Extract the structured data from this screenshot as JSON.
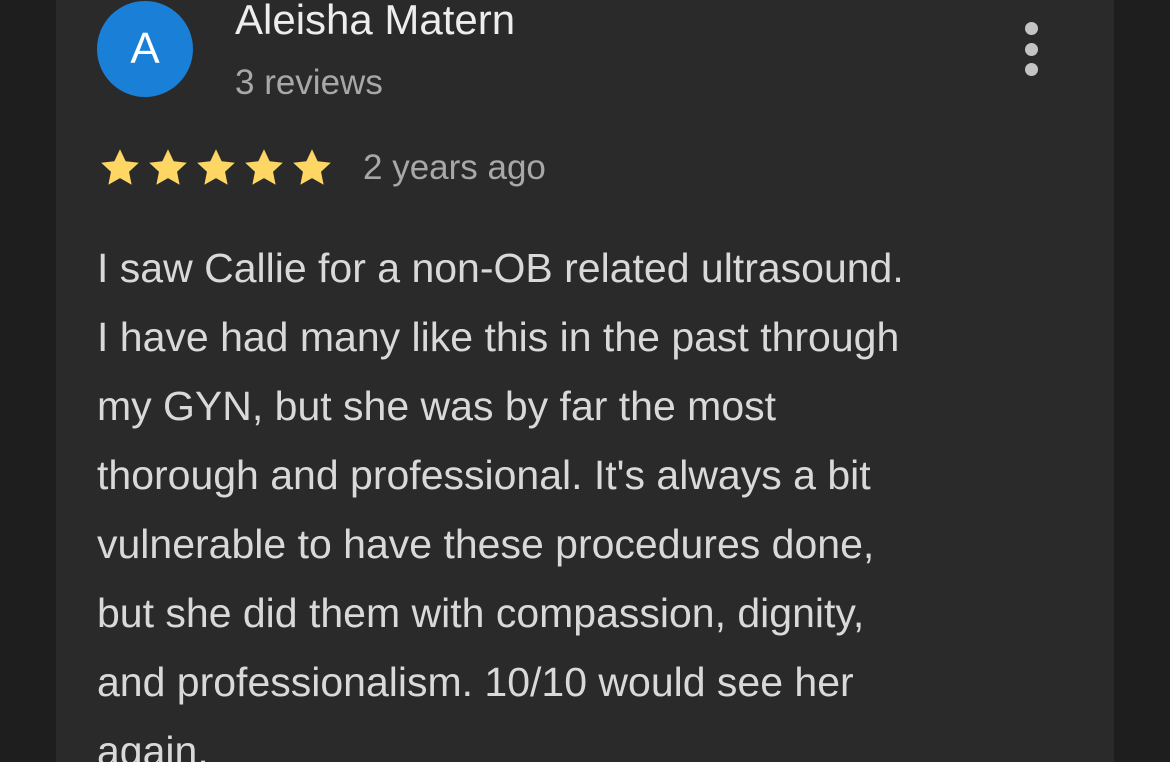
{
  "review": {
    "avatar_letter": "A",
    "author_name": "Aleisha Matern",
    "review_count": "3 reviews",
    "rating": 5,
    "rating_max": 5,
    "time_ago": "2 years ago",
    "text_lines": [
      "I saw Callie for a non-OB related ultrasound.",
      "I have had many like this in the past through",
      "my GYN, but she was by far the most",
      "thorough and professional. It's always a bit",
      "vulnerable to have these procedures done,",
      "but she did them with compassion, dignity,",
      "and professionalism. 10/10 would see her",
      "again."
    ]
  },
  "icons": {
    "more": "more-vert-icon",
    "star": "star-icon"
  },
  "colors": {
    "background": "#1e1e1e",
    "card": "#2a2a2a",
    "avatar": "#1a7fd6",
    "star": "#fdd663",
    "primary_text": "#ededed",
    "secondary_text": "#a8a8a8"
  }
}
